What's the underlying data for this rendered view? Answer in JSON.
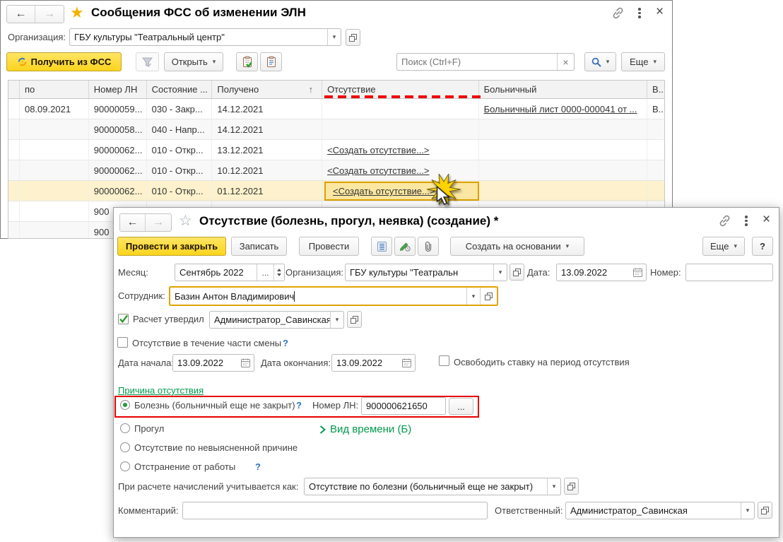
{
  "icons": {
    "sort_asc": "↑",
    "help": "?",
    "ellipsis": "..."
  },
  "bgWindow": {
    "title": "Сообщения ФСС об изменении ЭЛН",
    "org": {
      "label": "Организация:",
      "value": "ГБУ культуры \"Театральный центр\""
    },
    "toolbar": {
      "getFss": "Получить из ФСС",
      "open": "Открыть",
      "searchPlaceholder": "Поиск (Ctrl+F)",
      "more": "Еще"
    },
    "table": {
      "headers": {
        "po": "по",
        "ln": "Номер ЛН",
        "state": "Состояние ...",
        "received": "Получено",
        "absence": "Отсутствие",
        "sick": "Больничный",
        "v": "В..."
      },
      "rows": [
        {
          "po": "08.09.2021",
          "ln": "90000059...",
          "state": "030 - Закр...",
          "received": "14.12.2021",
          "absence": "",
          "sick": "Больничный лист 0000-000041 от ...",
          "v": "В..."
        },
        {
          "po": "",
          "ln": "90000058...",
          "state": "040 - Напр...",
          "received": "14.12.2021",
          "absence": "",
          "sick": "",
          "v": ""
        },
        {
          "po": "",
          "ln": "90000062...",
          "state": "010 - Откр...",
          "received": "13.12.2021",
          "absence": "<Создать отсутствие...>",
          "sick": "",
          "v": ""
        },
        {
          "po": "",
          "ln": "90000062...",
          "state": "010 - Откр...",
          "received": "10.12.2021",
          "absence": "<Создать отсутствие...>",
          "sick": "",
          "v": ""
        },
        {
          "po": "",
          "ln": "90000062...",
          "state": "010 - Откр...",
          "received": "01.12.2021",
          "absence": "<Создать отсутствие...>",
          "sick": "",
          "v": ""
        },
        {
          "po": "",
          "ln": "900",
          "state": "",
          "received": "",
          "absence": "",
          "sick": "",
          "v": ""
        },
        {
          "po": "",
          "ln": "900",
          "state": "",
          "received": "",
          "absence": "",
          "sick": "",
          "v": ""
        }
      ]
    }
  },
  "fgWindow": {
    "title": "Отсутствие (болезнь, прогул, неявка) (создание) *",
    "toolbar": {
      "postClose": "Провести и закрыть",
      "write": "Записать",
      "post": "Провести",
      "createBased": "Создать на основании",
      "more": "Еще"
    },
    "fields": {
      "monthLabel": "Месяц:",
      "monthValue": "Сентябрь 2022",
      "orgLabel": "Организация:",
      "orgValue": "ГБУ культуры \"Театральн",
      "dateLabel": "Дата:",
      "dateValue": "13.09.2022",
      "numberLabel": "Номер:",
      "numberValue": "",
      "employeeLabel": "Сотрудник:",
      "employeeValue": "Базин Антон Владимирович",
      "approveLabel": "Расчет утвердил",
      "approveValue": "Администратор_Савинская",
      "partShiftLabel": "Отсутствие в течение части смены",
      "startLabel": "Дата начала:",
      "startValue": "13.09.2022",
      "endLabel": "Дата окончания:",
      "endValue": "13.09.2022",
      "releaseLabel": "Освободить ставку на период отсутствия",
      "reasonGroupLabel": "Причина отсутствия",
      "reasonIllness": "Болезнь (больничный еще не закрыт)",
      "lnLabel": "Номер ЛН:",
      "lnValue": "900000621650",
      "reasonTruancy": "Прогул",
      "reasonUnknown": "Отсутствие по невыясненной причине",
      "reasonSuspension": "Отстранение от работы",
      "timeKindLink": "Вид времени (Б)",
      "calcLabel": "При расчете начислений учитывается как:",
      "calcValue": "Отсутствие по болезни (больничный еще не закрыт)",
      "commentLabel": "Комментарий:",
      "commentValue": "",
      "responsibleLabel": "Ответственный:",
      "responsibleValue": "Администратор_Савинская"
    }
  }
}
